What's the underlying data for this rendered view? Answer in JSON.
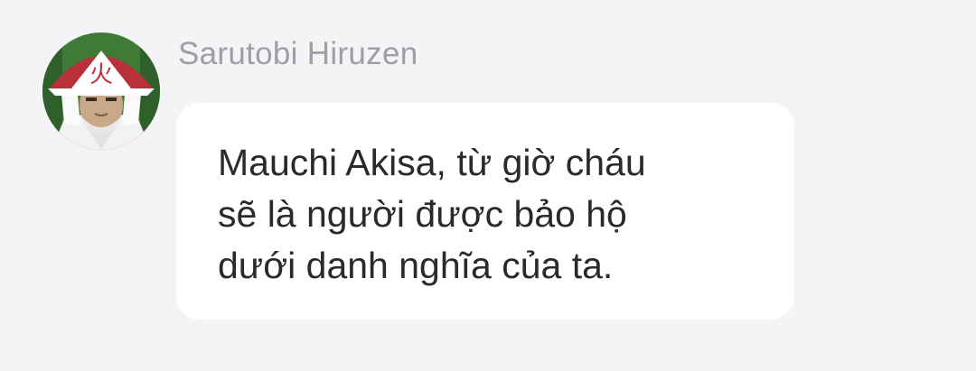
{
  "message": {
    "sender": {
      "name": "Sarutobi Hiruzen",
      "avatar_icon": "hokage-avatar-icon"
    },
    "text_lines": [
      "Mauchi Akisa, từ giờ cháu",
      "sẽ là người được bảo hộ",
      "dưới danh nghĩa của ta."
    ],
    "hat_kanji": "火"
  },
  "colors": {
    "background": "#f4f4f6",
    "bubble": "#ffffff",
    "sender_name": "#9e9ea4",
    "message_text": "#2a2a2e"
  }
}
